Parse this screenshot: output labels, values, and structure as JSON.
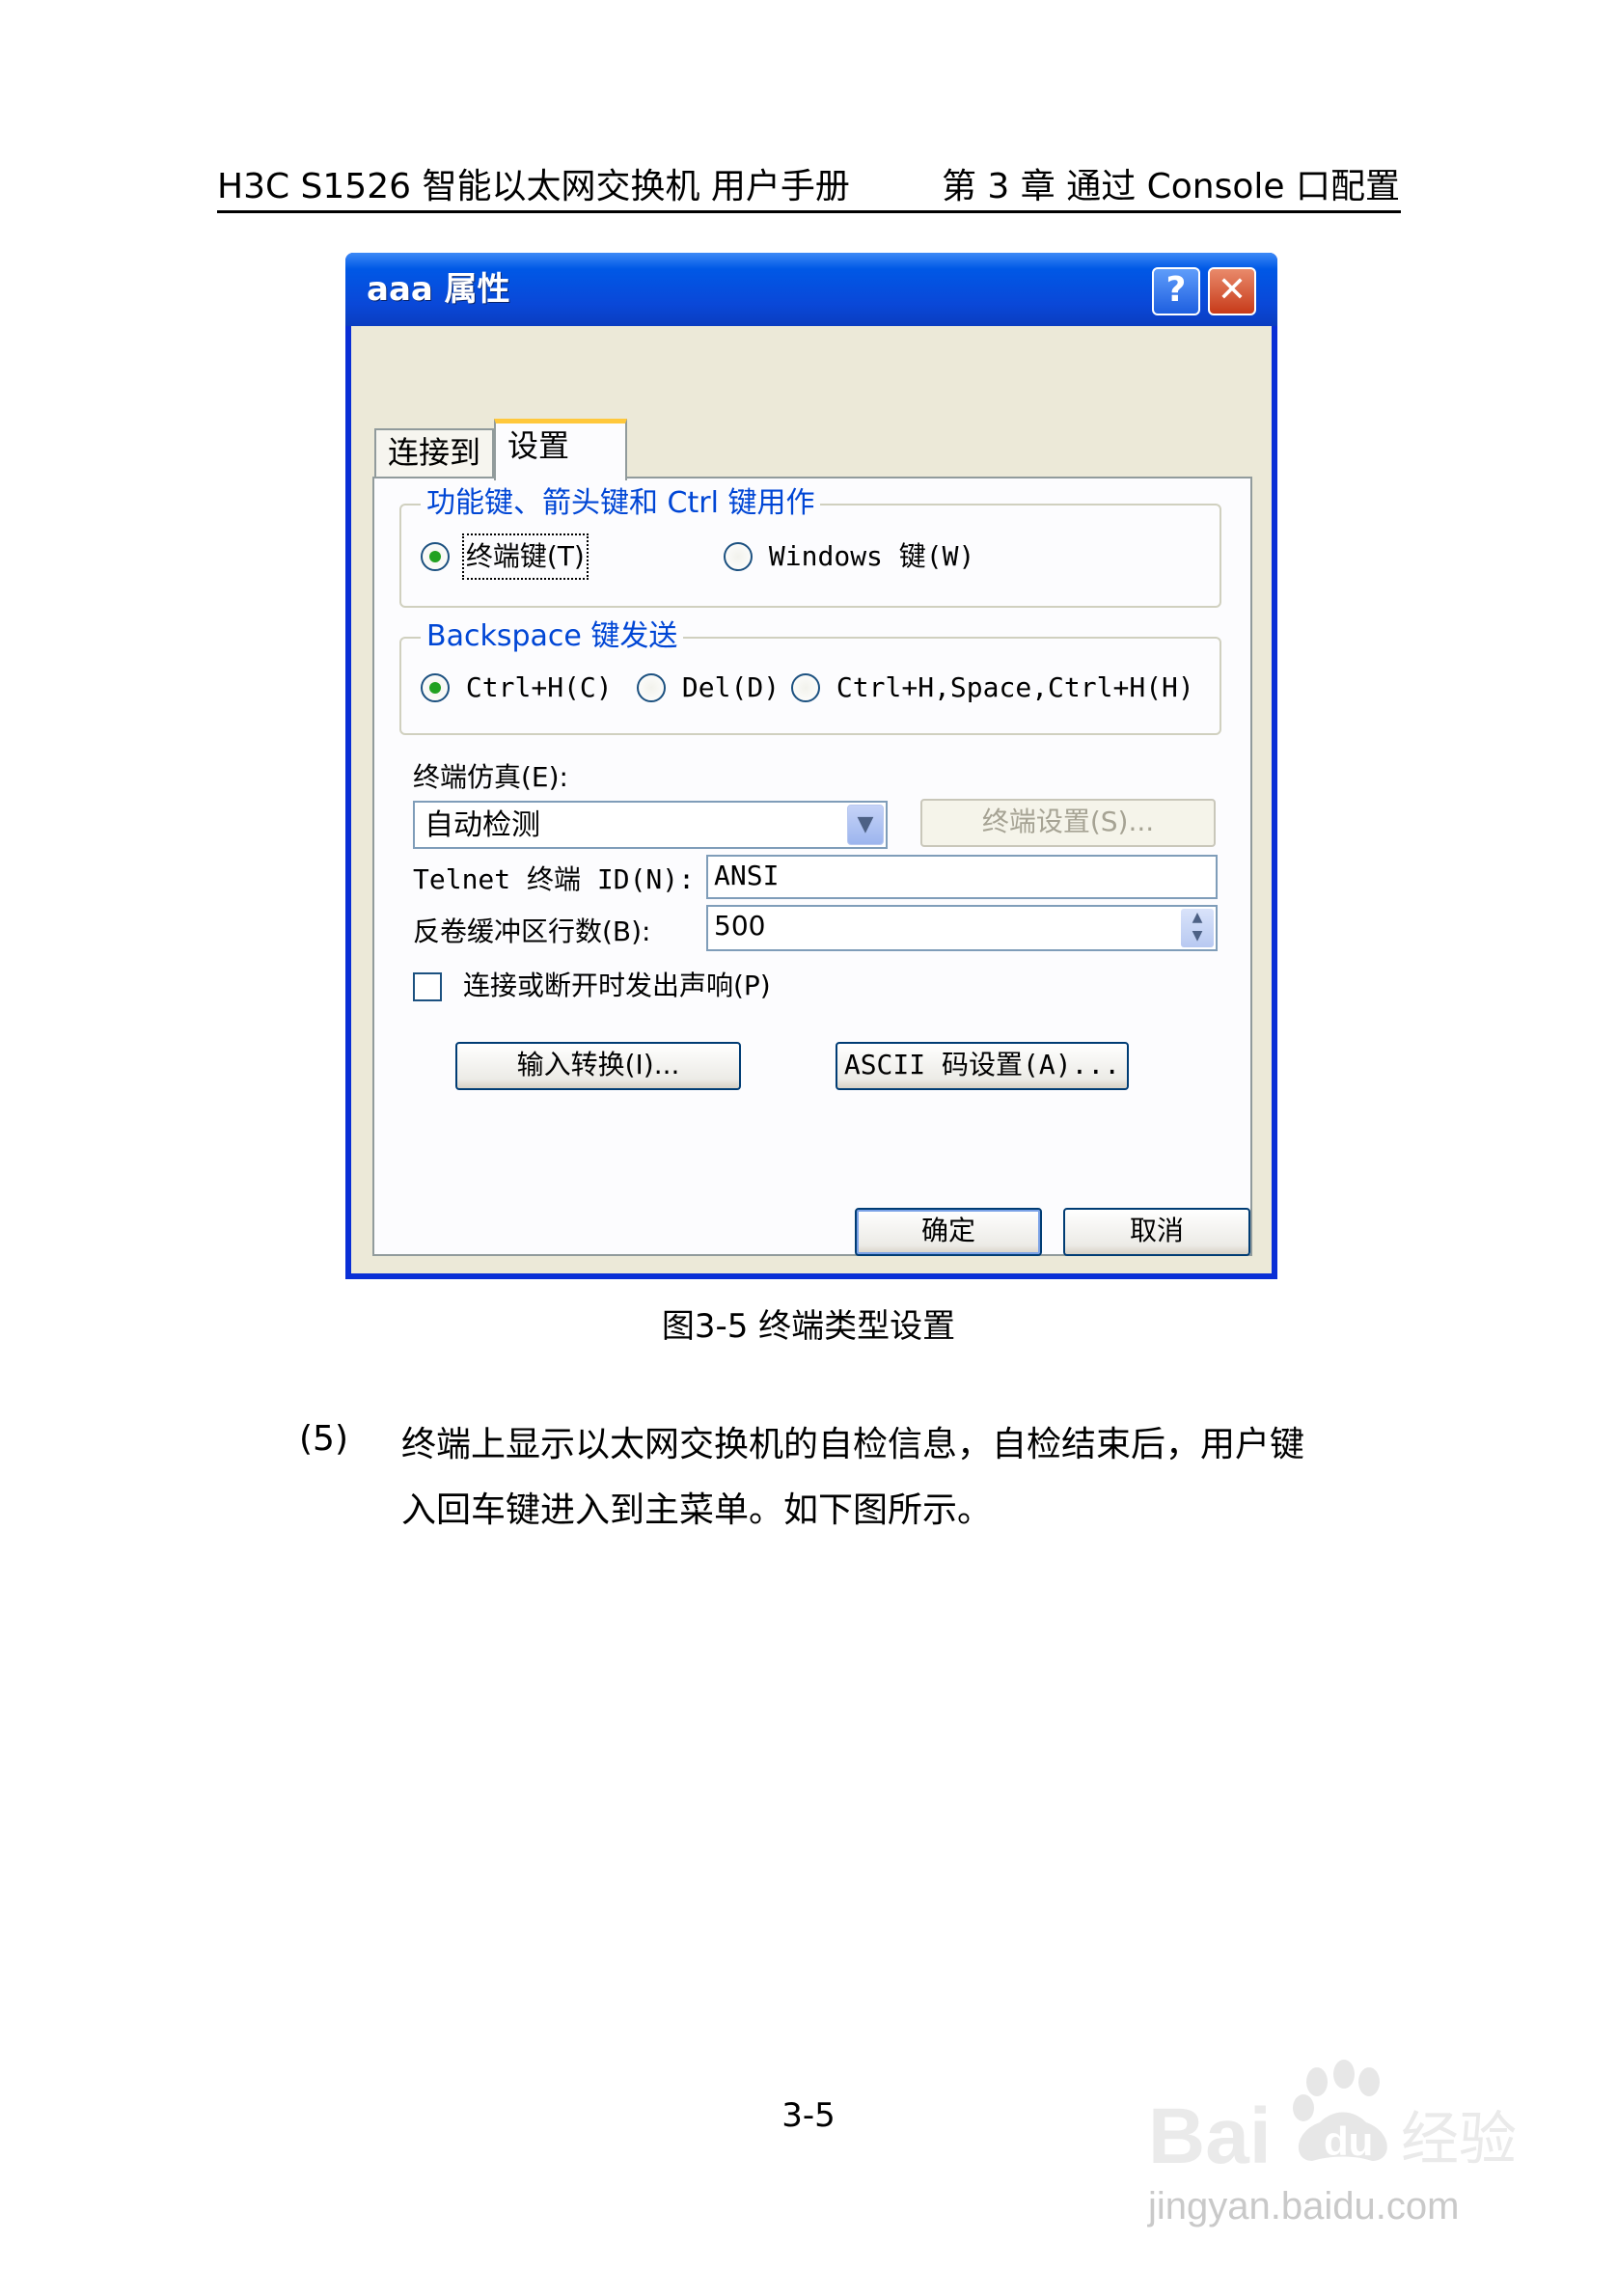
{
  "header": {
    "left": "H3C S1526 智能以太网交换机  用户手册",
    "right": "第 3 章  通过 Console 口配置"
  },
  "dialog": {
    "title": "aaa 属性",
    "help_glyph": "?",
    "close_glyph": "✕",
    "tabs": [
      "连接到",
      "设置"
    ],
    "function_group": {
      "title": "功能键、箭头键和 Ctrl 键用作",
      "options": [
        "终端键(T)",
        "Windows 键(W)"
      ],
      "selected": "终端键(T)"
    },
    "backspace_group": {
      "title": "Backspace 键发送",
      "options": [
        "Ctrl+H(C)",
        "Del(D)",
        "Ctrl+H,Space,Ctrl+H(H)"
      ],
      "selected": "Ctrl+H(C)"
    },
    "emulation_label": "终端仿真(E):",
    "emulation_value": "自动检测",
    "terminal_settings_button": "终端设置(S)...",
    "telnet_label": "Telnet 终端 ID(N):",
    "telnet_value": "ANSI",
    "buffer_label": "反卷缓冲区行数(B):",
    "buffer_value": "500",
    "beep_label": "连接或断开时发出声响(P)",
    "beep_checked": false,
    "input_translation_button": "输入转换(I)...",
    "ascii_button": "ASCII 码设置(A)...",
    "ok_button": "确定",
    "cancel_button": "取消"
  },
  "caption": "图3-5  终端类型设置",
  "step": {
    "number": "(5)",
    "line1": "终端上显示以太网交换机的自检信息，自检结束后，用户键",
    "line2": "入回车键进入到主菜单。如下图所示。"
  },
  "page_number": "3-5",
  "watermark": {
    "brand": "Bai经验",
    "url": "jingyan.baidu.com"
  },
  "colors": {
    "title_bar": "#0a48d8",
    "dialog_bg": "#ece9d8",
    "group_title": "#0046d5",
    "radio_dot": "#21a121"
  }
}
